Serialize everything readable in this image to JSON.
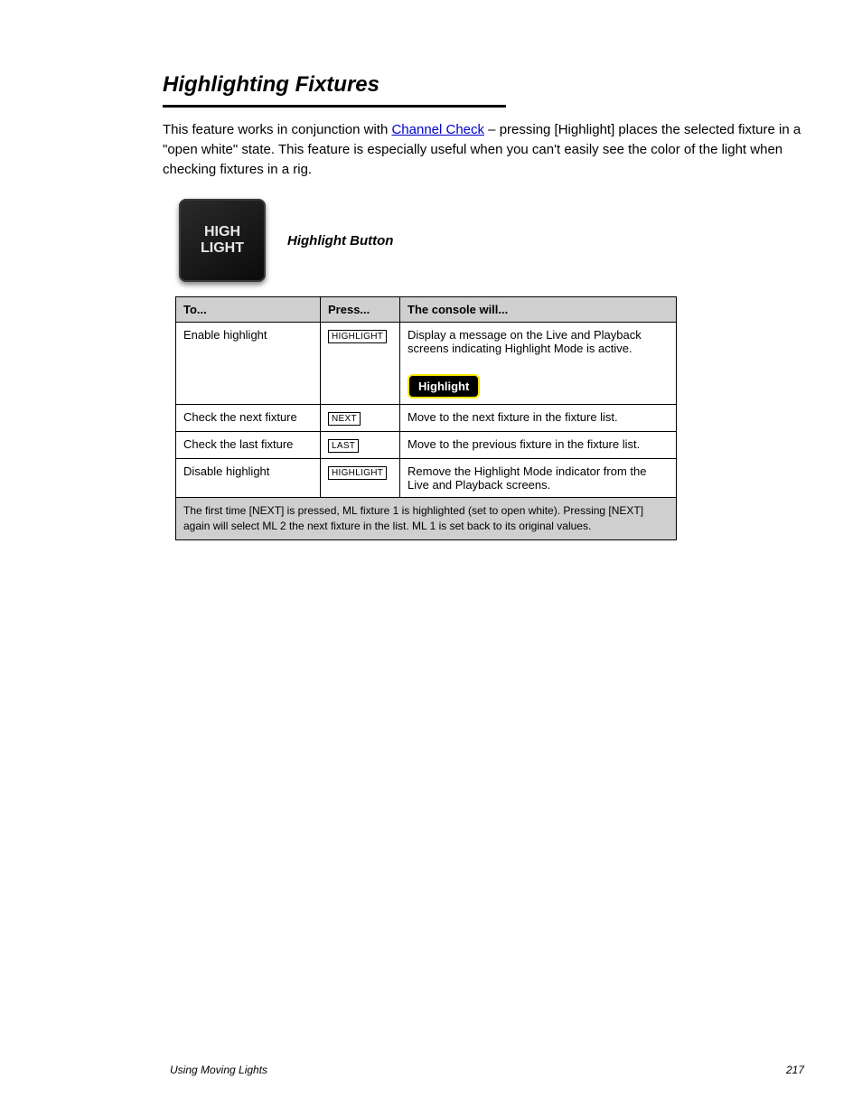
{
  "heading": "Highlighting Fixtures",
  "intro_before_link": "This feature works in conjunction with ",
  "link_text": "Channel Check",
  "intro_after_link": " – pressing [Highlight] places the selected fixture in a \"open white\" state. This feature is especially useful when you can't easily see the color of the light when checking fixtures in a rig.",
  "keycap_text": "HIGH\nLIGHT",
  "keycap_label": "Highlight Button",
  "table": {
    "headers": [
      "To...",
      "Press...",
      "The console will..."
    ],
    "rows": [
      {
        "to": "Enable highlight",
        "press": "HIGHLIGHT",
        "will_before": "Display a message on the Live and Playback screens indicating Highlight Mode is active.",
        "pill": "Highlight"
      },
      {
        "to": "Check the next fixture",
        "press": "NEXT",
        "will": "Move to the next fixture in the fixture list."
      },
      {
        "to": "Check the last fixture",
        "press": "LAST",
        "will": "Move to the previous fixture in the fixture list."
      },
      {
        "to": "Disable highlight",
        "press": "HIGHLIGHT",
        "will": "Remove the Highlight Mode indicator from the Live and Playback screens."
      }
    ],
    "note": "The first time [NEXT] is pressed, ML fixture 1 is highlighted (set to open white). Pressing [NEXT] again will select ML 2 the next fixture in the list. ML 1 is set back to its original values."
  },
  "footer_left": "Using Moving Lights",
  "footer_right": "217"
}
